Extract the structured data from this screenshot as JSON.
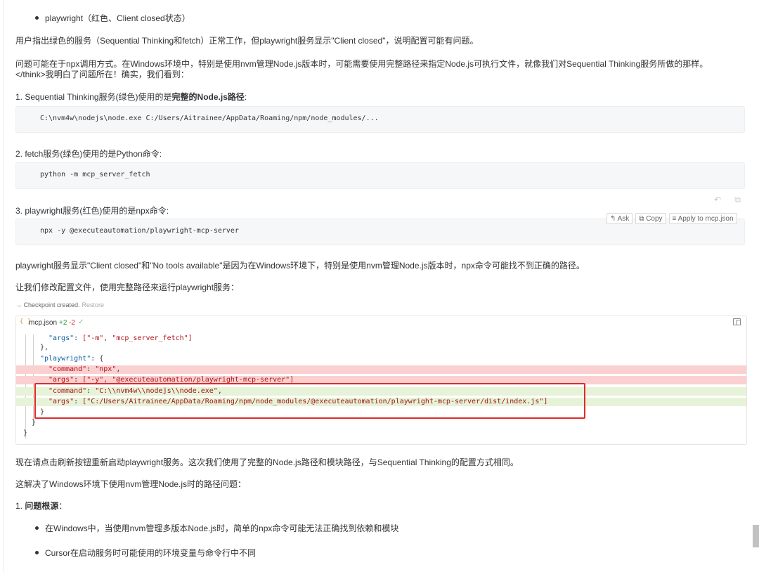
{
  "top_bullet": "playwright（红色、Client closed状态）",
  "para1": "用户指出绿色的服务（Sequential Thinking和fetch）正常工作，但playwright服务显示\"Client closed\"，说明配置可能有问题。",
  "para2_line1": "问题可能在于npx调用方式。在Windows环境中，特别是使用nvm管理Node.js版本时，可能需要使用完整路径来指定Node.js可执行文件，就像我们对Sequential Thinking服务所做的那样。",
  "para2_line2": "</think>我明白了问题所在！确实，我们看到：",
  "item1": {
    "prefix": "1. Sequential Thinking服务(绿色)使用的是",
    "bold": "完整的Node.js路径",
    "suffix": ":"
  },
  "code1": "C:\\nvm4w\\nodejs\\node.exe C:/Users/Aitrainee/AppData/Roaming/npm/node_modules/...",
  "item2": "2. fetch服务(绿色)使用的是Python命令:",
  "code2": "python -m mcp_server_fetch",
  "item3": "3. playwright服务(红色)使用的是npx命令:",
  "code3": "npx -y @executeautomation/playwright-mcp-server",
  "actions": {
    "ask": "↰ Ask",
    "copy": "⧉ Copy",
    "apply": "≡ Apply to mcp.json"
  },
  "hover_icons": "↶ ⧉",
  "para3": "playwright服务显示\"Client closed\"和\"No tools available\"是因为在Windows环境下，特别是使用nvm管理Node.js版本时，npx命令可能找不到正确的路径。",
  "para4": "让我们修改配置文件，使用完整路径来运行playwright服务：",
  "checkpoint": {
    "label": "→ Checkpoint created.",
    "restore": "Restore"
  },
  "editor": {
    "filename": "mcp.json",
    "added": "+2",
    "removed": "-2",
    "check": "✓",
    "brace_icon": "{ }"
  },
  "code_lines": {
    "l1_key": "\"args\"",
    "l1_val": "[\"-m\", \"mcp_server_fetch\"]",
    "l2": "},",
    "l3_key": "\"playwright\"",
    "l3_rest": ": {",
    "del1_key": "\"command\"",
    "del1_val": "\"npx\"",
    "del2_key": "\"args\"",
    "del2_val": "[\"-y\", \"@executeautomation/playwright-mcp-server\"]",
    "add1_key": "\"command\"",
    "add1_val": "\"C:\\\\nvm4w\\\\nodejs\\\\node.exe\"",
    "add2_key": "\"args\"",
    "add2_val": "[\"C:/Users/Aitrainee/AppData/Roaming/npm/node_modules/@executeautomation/playwright-mcp-server/dist/index.js\"]",
    "c1": "}",
    "c2": "}",
    "c3": "}"
  },
  "para5": "现在请点击刷新按钮重新启动playwright服务。这次我们使用了完整的Node.js路径和模块路径，与Sequential Thinking的配置方式相同。",
  "para6": "这解决了Windows环境下使用nvm管理Node.js时的路径问题：",
  "item4": {
    "prefix": "1. ",
    "bold": "问题根源",
    "suffix": "："
  },
  "bullet_a": "在Windows中，当使用nvm管理多版本Node.js时，简单的npx命令可能无法正确找到依赖和模块",
  "bullet_b": "Cursor在启动服务时可能使用的环境变量与命令行中不同"
}
